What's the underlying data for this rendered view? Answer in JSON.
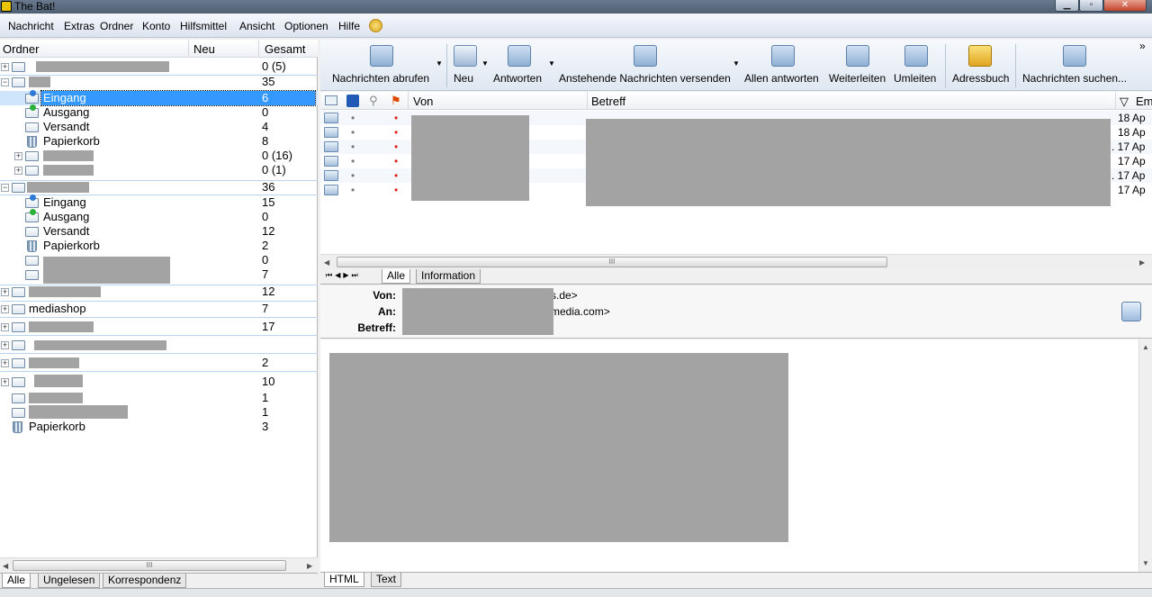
{
  "window": {
    "title": "The Bat!"
  },
  "menu": {
    "items": [
      "Nachricht",
      "Extras",
      "Ordner",
      "Konto",
      "Hilfsmittel",
      "Ansicht",
      "Optionen",
      "Hilfe"
    ]
  },
  "folders": {
    "columns": {
      "name": "Ordner",
      "new": "Neu",
      "total": "Gesamt"
    },
    "rows": [
      {
        "name": "",
        "count": "0 (5)"
      },
      {
        "name": "",
        "count": "35"
      },
      {
        "name": "Eingang",
        "count": "6"
      },
      {
        "name": "Ausgang",
        "count": "0"
      },
      {
        "name": "Versandt",
        "count": "4"
      },
      {
        "name": "Papierkorb",
        "count": "8"
      },
      {
        "name": "",
        "count": "0 (16)"
      },
      {
        "name": "",
        "count": "0 (1)"
      },
      {
        "name": "",
        "count": "36"
      },
      {
        "name": "Eingang",
        "count": "15"
      },
      {
        "name": "Ausgang",
        "count": "0"
      },
      {
        "name": "Versandt",
        "count": "12"
      },
      {
        "name": "Papierkorb",
        "count": "2"
      },
      {
        "name": "",
        "count": "0"
      },
      {
        "name": "",
        "count": "7"
      },
      {
        "name": "",
        "count": "12"
      },
      {
        "name": "mediashop",
        "count": "7"
      },
      {
        "name": "",
        "count": "17"
      },
      {
        "name": "",
        "count": ""
      },
      {
        "name": "",
        "count": "2"
      },
      {
        "name": "",
        "count": "10"
      },
      {
        "name": "",
        "count": "1"
      },
      {
        "name": "",
        "count": "1"
      },
      {
        "name": "Papierkorb",
        "count": "3"
      }
    ],
    "tabs": [
      "Alle",
      "Ungelesen",
      "Korrespondenz"
    ]
  },
  "toolbar": {
    "buttons": [
      "Nachrichten abrufen",
      "Neu",
      "Antworten",
      "Anstehende Nachrichten versenden",
      "Allen antworten",
      "Weiterleiten",
      "Umleiten",
      "Adressbuch",
      "Nachrichten suchen..."
    ],
    "overflow": "»"
  },
  "messages": {
    "columns": {
      "from": "Von",
      "subject": "Betreff",
      "date": "Em"
    },
    "rows": [
      {
        "date": "18 Ap"
      },
      {
        "date": "18 Ap"
      },
      {
        "date": ". 17 Ap"
      },
      {
        "date": "17 Ap"
      },
      {
        "date": ". 17 Ap"
      },
      {
        "date": "17 Ap"
      }
    ]
  },
  "preview": {
    "tabs": [
      "Alle",
      "Information"
    ],
    "labels": {
      "from": "Von:",
      "to": "An:",
      "subject": "Betreff:"
    },
    "from_tail": "s.de>",
    "to_tail": "media.com>",
    "bottom_tabs": [
      "HTML",
      "Text"
    ]
  }
}
